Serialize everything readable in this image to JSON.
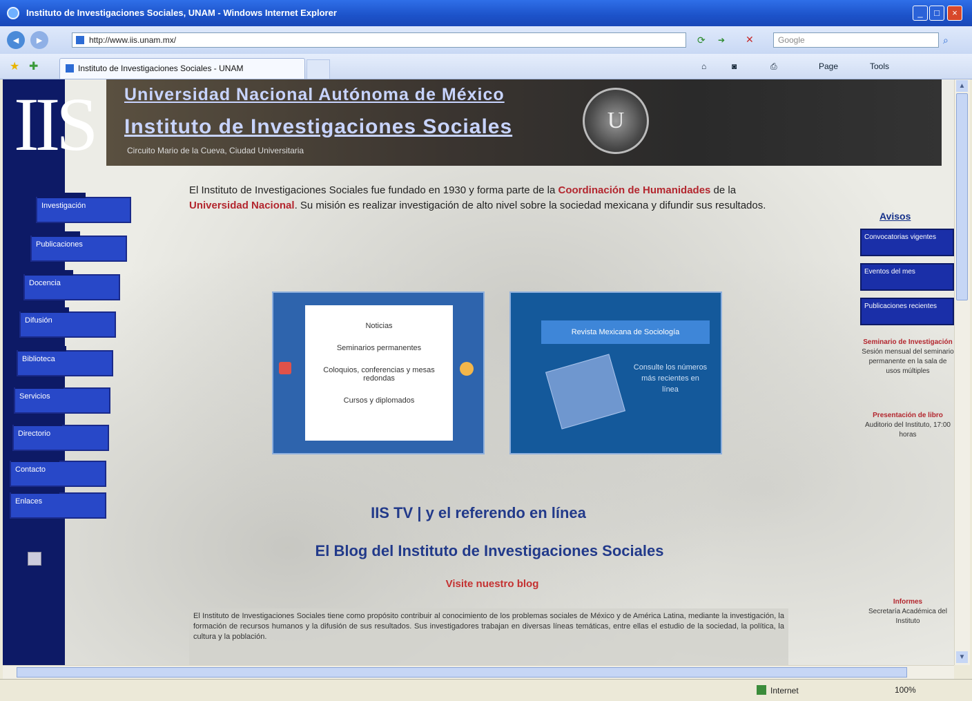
{
  "window": {
    "title": "Instituto de Investigaciones Sociales, UNAM - Windows Internet Explorer"
  },
  "toolbar": {
    "address": "http://www.iis.unam.mx/",
    "search_placeholder": "Google",
    "tab_label": "Instituto de Investigaciones Sociales - UNAM",
    "commands": [
      "Page",
      "Tools"
    ]
  },
  "site": {
    "logo_text": "IIS",
    "banner_line1": "Universidad Nacional Autónoma de México",
    "banner_line2": "Instituto de Investigaciones Sociales",
    "banner_sub": "Circuito Mario de la Cueva, Ciudad Universitaria",
    "seal_text": "U"
  },
  "left_nav": [
    "Investigación",
    "Publicaciones",
    "Docencia",
    "Difusión",
    "Biblioteca",
    "Servicios",
    "Directorio",
    "Contacto",
    "Enlaces"
  ],
  "intro": {
    "part1": "El Instituto de Investigaciones Sociales fue fundado en 1930 y forma parte de la ",
    "red1": "Coordinación de Humanidades",
    "part2": " de la ",
    "red2": "Universidad Nacional",
    "part3": ". Su misión es realizar investigación de alto nivel sobre la sociedad mexicana y difundir sus resultados."
  },
  "panels": {
    "left_lines": [
      "Noticias",
      "Seminarios permanentes",
      "Coloquios, conferencias y mesas redondas",
      "Cursos y diplomados"
    ],
    "right_bar": "Revista Mexicana de Sociología",
    "right_text": "Consulte los números más recientes en línea"
  },
  "links": {
    "main1": "IIS TV | y el referendo en línea",
    "main2": "El Blog del Instituto de Investigaciones Sociales",
    "red": "Visite nuestro blog"
  },
  "bottom_text": "El Instituto de Investigaciones Sociales tiene como propósito contribuir al conocimiento de los problemas sociales de México y de América Latina, mediante la investigación, la formación de recursos humanos y la difusión de sus resultados. Sus investigadores trabajan en diversas líneas temáticas, entre ellas el estudio de la sociedad, la política, la cultura y la población.",
  "right_col": {
    "heading": "Avisos",
    "buttons": [
      "Convocatorias vigentes",
      "Eventos del mes",
      "Publicaciones recientes"
    ],
    "texts": [
      {
        "red": "Seminario de Investigación",
        "body": "Sesión mensual del seminario permanente en la sala de usos múltiples"
      },
      {
        "red": "Presentación de libro",
        "body": "Auditorio del Instituto, 17:00 horas"
      },
      {
        "red": "Informes",
        "body": "Secretaría Académica del Instituto"
      }
    ]
  },
  "status": {
    "zone": "Internet",
    "zoom": "100%"
  },
  "colors": {
    "nav_dark": "#0d1a66",
    "nav_button": "#2848c8",
    "link_blue": "#223a8a",
    "accent_red": "#b3262e"
  }
}
